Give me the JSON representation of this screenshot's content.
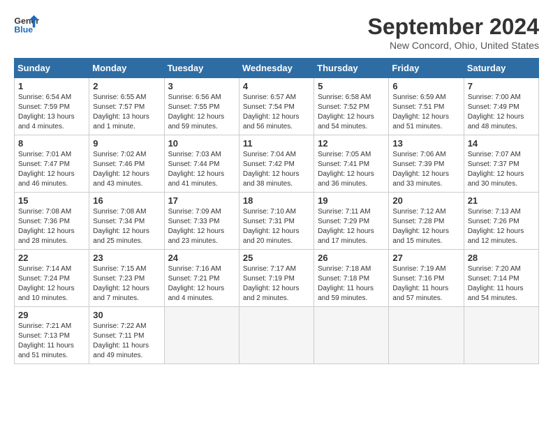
{
  "header": {
    "logo_line1": "General",
    "logo_line2": "Blue",
    "month_title": "September 2024",
    "location": "New Concord, Ohio, United States"
  },
  "weekdays": [
    "Sunday",
    "Monday",
    "Tuesday",
    "Wednesday",
    "Thursday",
    "Friday",
    "Saturday"
  ],
  "days": [
    {
      "day": "",
      "empty": true
    },
    {
      "day": "",
      "empty": true
    },
    {
      "day": "",
      "empty": true
    },
    {
      "day": "",
      "empty": true
    },
    {
      "day": "",
      "empty": true
    },
    {
      "day": "",
      "empty": true
    },
    {
      "day": "7",
      "sunrise": "7:00 AM",
      "sunset": "7:49 PM",
      "daylight": "12 hours and 48 minutes"
    },
    {
      "day": "8",
      "sunrise": "7:01 AM",
      "sunset": "7:47 PM",
      "daylight": "12 hours and 46 minutes"
    },
    {
      "day": "9",
      "sunrise": "7:02 AM",
      "sunset": "7:46 PM",
      "daylight": "12 hours and 43 minutes"
    },
    {
      "day": "10",
      "sunrise": "7:03 AM",
      "sunset": "7:44 PM",
      "daylight": "12 hours and 41 minutes"
    },
    {
      "day": "11",
      "sunrise": "7:04 AM",
      "sunset": "7:42 PM",
      "daylight": "12 hours and 38 minutes"
    },
    {
      "day": "12",
      "sunrise": "7:05 AM",
      "sunset": "7:41 PM",
      "daylight": "12 hours and 36 minutes"
    },
    {
      "day": "13",
      "sunrise": "7:06 AM",
      "sunset": "7:39 PM",
      "daylight": "12 hours and 33 minutes"
    },
    {
      "day": "14",
      "sunrise": "7:07 AM",
      "sunset": "7:37 PM",
      "daylight": "12 hours and 30 minutes"
    },
    {
      "day": "15",
      "sunrise": "7:08 AM",
      "sunset": "7:36 PM",
      "daylight": "12 hours and 28 minutes"
    },
    {
      "day": "16",
      "sunrise": "7:08 AM",
      "sunset": "7:34 PM",
      "daylight": "12 hours and 25 minutes"
    },
    {
      "day": "17",
      "sunrise": "7:09 AM",
      "sunset": "7:33 PM",
      "daylight": "12 hours and 23 minutes"
    },
    {
      "day": "18",
      "sunrise": "7:10 AM",
      "sunset": "7:31 PM",
      "daylight": "12 hours and 20 minutes"
    },
    {
      "day": "19",
      "sunrise": "7:11 AM",
      "sunset": "7:29 PM",
      "daylight": "12 hours and 17 minutes"
    },
    {
      "day": "20",
      "sunrise": "7:12 AM",
      "sunset": "7:28 PM",
      "daylight": "12 hours and 15 minutes"
    },
    {
      "day": "21",
      "sunrise": "7:13 AM",
      "sunset": "7:26 PM",
      "daylight": "12 hours and 12 minutes"
    },
    {
      "day": "22",
      "sunrise": "7:14 AM",
      "sunset": "7:24 PM",
      "daylight": "12 hours and 10 minutes"
    },
    {
      "day": "23",
      "sunrise": "7:15 AM",
      "sunset": "7:23 PM",
      "daylight": "12 hours and 7 minutes"
    },
    {
      "day": "24",
      "sunrise": "7:16 AM",
      "sunset": "7:21 PM",
      "daylight": "12 hours and 4 minutes"
    },
    {
      "day": "25",
      "sunrise": "7:17 AM",
      "sunset": "7:19 PM",
      "daylight": "12 hours and 2 minutes"
    },
    {
      "day": "26",
      "sunrise": "7:18 AM",
      "sunset": "7:18 PM",
      "daylight": "11 hours and 59 minutes"
    },
    {
      "day": "27",
      "sunrise": "7:19 AM",
      "sunset": "7:16 PM",
      "daylight": "11 hours and 57 minutes"
    },
    {
      "day": "28",
      "sunrise": "7:20 AM",
      "sunset": "7:14 PM",
      "daylight": "11 hours and 54 minutes"
    },
    {
      "day": "29",
      "sunrise": "7:21 AM",
      "sunset": "7:13 PM",
      "daylight": "11 hours and 51 minutes"
    },
    {
      "day": "30",
      "sunrise": "7:22 AM",
      "sunset": "7:11 PM",
      "daylight": "11 hours and 49 minutes"
    },
    {
      "day": "",
      "empty": true
    },
    {
      "day": "",
      "empty": true
    },
    {
      "day": "",
      "empty": true
    },
    {
      "day": "",
      "empty": true
    },
    {
      "day": "",
      "empty": true
    }
  ],
  "week1": [
    {
      "day": "1",
      "sunrise": "6:54 AM",
      "sunset": "7:59 PM",
      "daylight": "13 hours and 4 minutes"
    },
    {
      "day": "2",
      "sunrise": "6:55 AM",
      "sunset": "7:57 PM",
      "daylight": "13 hours and 1 minute"
    },
    {
      "day": "3",
      "sunrise": "6:56 AM",
      "sunset": "7:55 PM",
      "daylight": "12 hours and 59 minutes"
    },
    {
      "day": "4",
      "sunrise": "6:57 AM",
      "sunset": "7:54 PM",
      "daylight": "12 hours and 56 minutes"
    },
    {
      "day": "5",
      "sunrise": "6:58 AM",
      "sunset": "7:52 PM",
      "daylight": "12 hours and 54 minutes"
    },
    {
      "day": "6",
      "sunrise": "6:59 AM",
      "sunset": "7:51 PM",
      "daylight": "12 hours and 51 minutes"
    },
    {
      "day": "7",
      "sunrise": "7:00 AM",
      "sunset": "7:49 PM",
      "daylight": "12 hours and 48 minutes"
    }
  ]
}
